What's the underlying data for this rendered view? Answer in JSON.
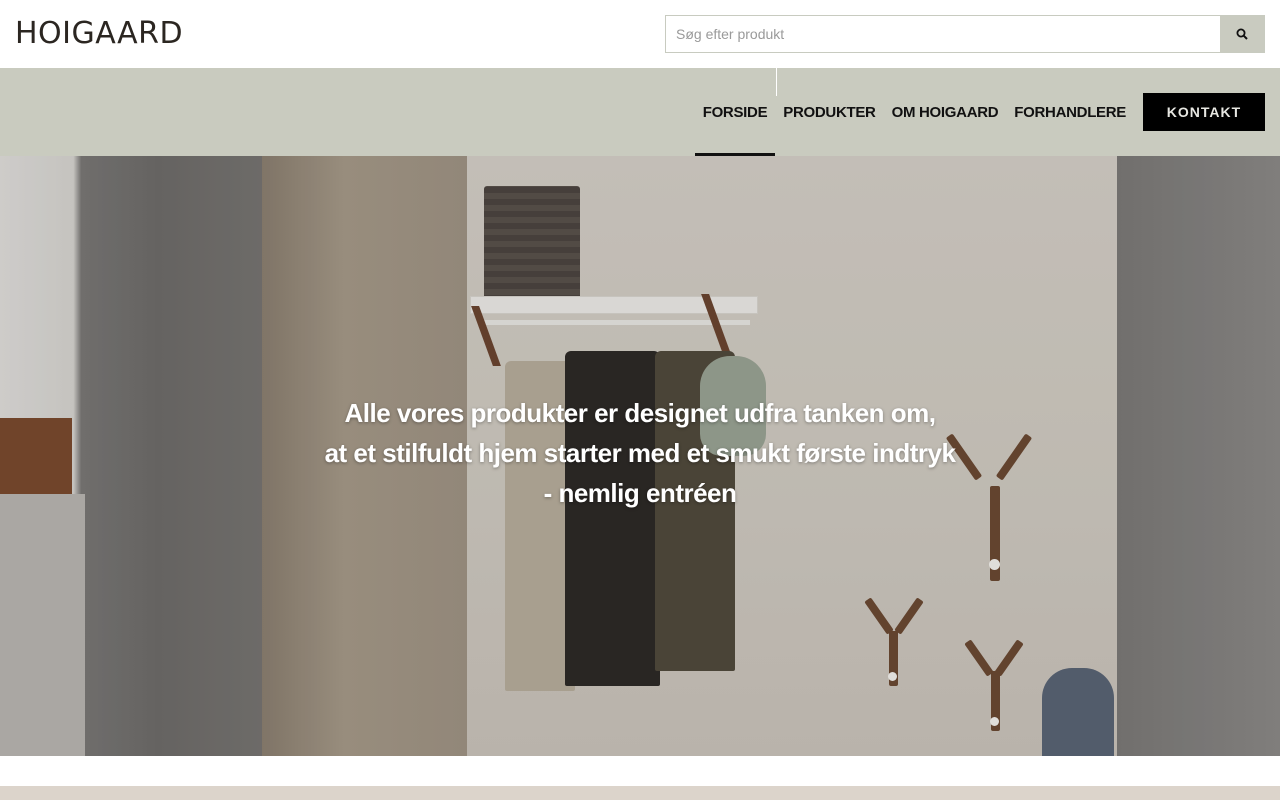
{
  "brand": {
    "logo_text": "HOIGAARD"
  },
  "search": {
    "placeholder": "Søg efter produkt",
    "value": "",
    "icon": "search-icon"
  },
  "nav": {
    "items": [
      {
        "label": "FORSIDE",
        "active": true
      },
      {
        "label": "PRODUKTER",
        "active": false
      },
      {
        "label": "OM HOIGAARD",
        "active": false
      },
      {
        "label": "FORHANDLERE",
        "active": false
      }
    ],
    "contact_label": "KONTAKT"
  },
  "hero": {
    "lines": [
      "Alle vores produkter er designet udfra tanken om,",
      "at et stilfuldt hjem starter med et smukt første indtryk",
      "- nemlig entréen"
    ]
  },
  "colors": {
    "nav_bg": "#c9cbbf",
    "search_button_bg": "#c9cbc0",
    "contact_bg": "#000000",
    "logo": "#2b2621",
    "footer_strip": "#dcd4cb"
  }
}
